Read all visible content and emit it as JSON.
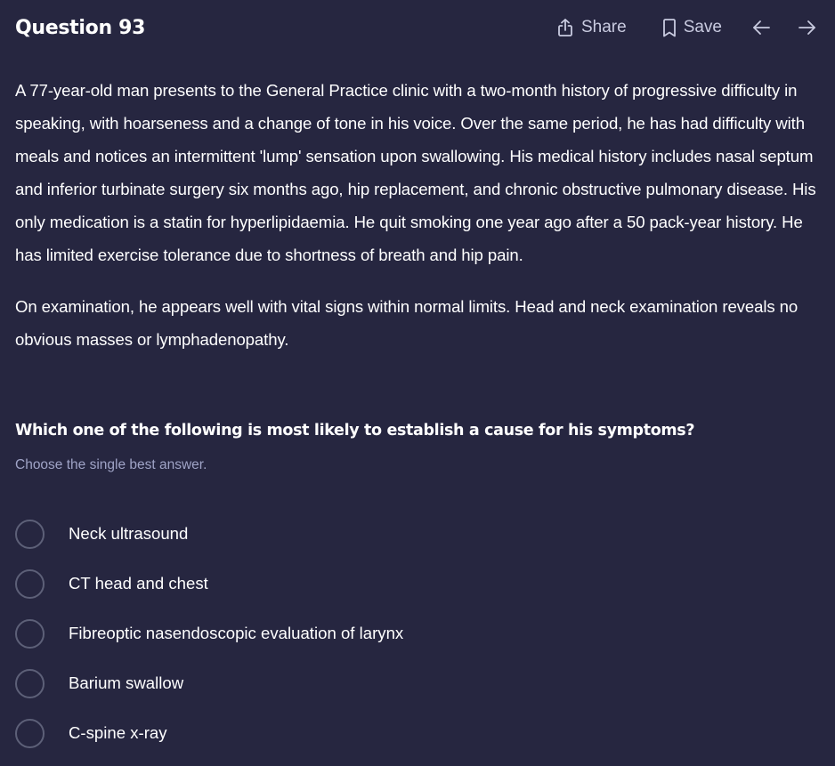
{
  "header": {
    "title": "Question 93",
    "share_label": "Share",
    "save_label": "Save",
    "icons": [
      "share-icon",
      "bookmark-icon",
      "arrow-left-icon",
      "arrow-right-icon"
    ]
  },
  "stem": {
    "paragraph1": "A 77-year-old man presents to the General Practice clinic with a two-month history of progressive difficulty in speaking, with hoarseness and a change of tone in his voice. Over the same period, he has had difficulty with meals and notices an intermittent 'lump' sensation upon swallowing. His medical history includes nasal septum and inferior turbinate surgery six months ago, hip replacement, and chronic obstructive pulmonary disease. His only medication is a statin for hyperlipidaemia. He quit smoking one year ago after a 50 pack-year history. He has limited exercise tolerance due to shortness of breath and hip pain.",
    "paragraph2": "On examination, he appears well with vital signs within normal limits. Head and neck examination reveals no obvious masses or lymphadenopathy."
  },
  "question": {
    "text": "Which one of the following is most likely to establish a cause for his symptoms?",
    "hint": "Choose the single best answer."
  },
  "options": [
    {
      "label": "Neck ultrasound"
    },
    {
      "label": "CT head and chest"
    },
    {
      "label": "Fibreoptic nasendoscopic evaluation of larynx"
    },
    {
      "label": "Barium swallow"
    },
    {
      "label": "C-spine x-ray"
    }
  ],
  "colors": {
    "background": "#262640",
    "text": "#ffffff",
    "muted": "#9fa3c6",
    "radio_border": "#5d6078"
  }
}
